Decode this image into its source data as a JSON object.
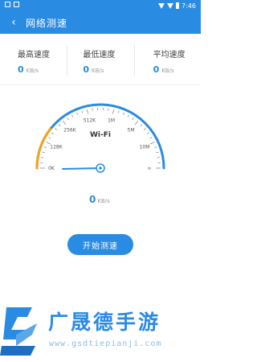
{
  "status_bar": {
    "time": "7:46"
  },
  "appbar": {
    "title": "网络测速"
  },
  "stats": [
    {
      "label": "最高速度",
      "value": "0",
      "unit": "KB/s"
    },
    {
      "label": "最低速度",
      "value": "0",
      "unit": "KB/s"
    },
    {
      "label": "平均速度",
      "value": "0",
      "unit": "KB/s"
    }
  ],
  "gauge": {
    "network": "Wi-Fi",
    "ticks": [
      "0K",
      "128K",
      "256K",
      "512K",
      "1M",
      "5M",
      "10M",
      "∞"
    ],
    "speed_level": 0,
    "colors": {
      "accent": "#2a8be2",
      "orange": "#f5a31a"
    }
  },
  "result": {
    "value": "0",
    "unit": "KB/s"
  },
  "start_button": {
    "label": "开始测速"
  },
  "watermark": {
    "brand": "广晟德手游",
    "url": "www.gsdtiepianji.com"
  }
}
